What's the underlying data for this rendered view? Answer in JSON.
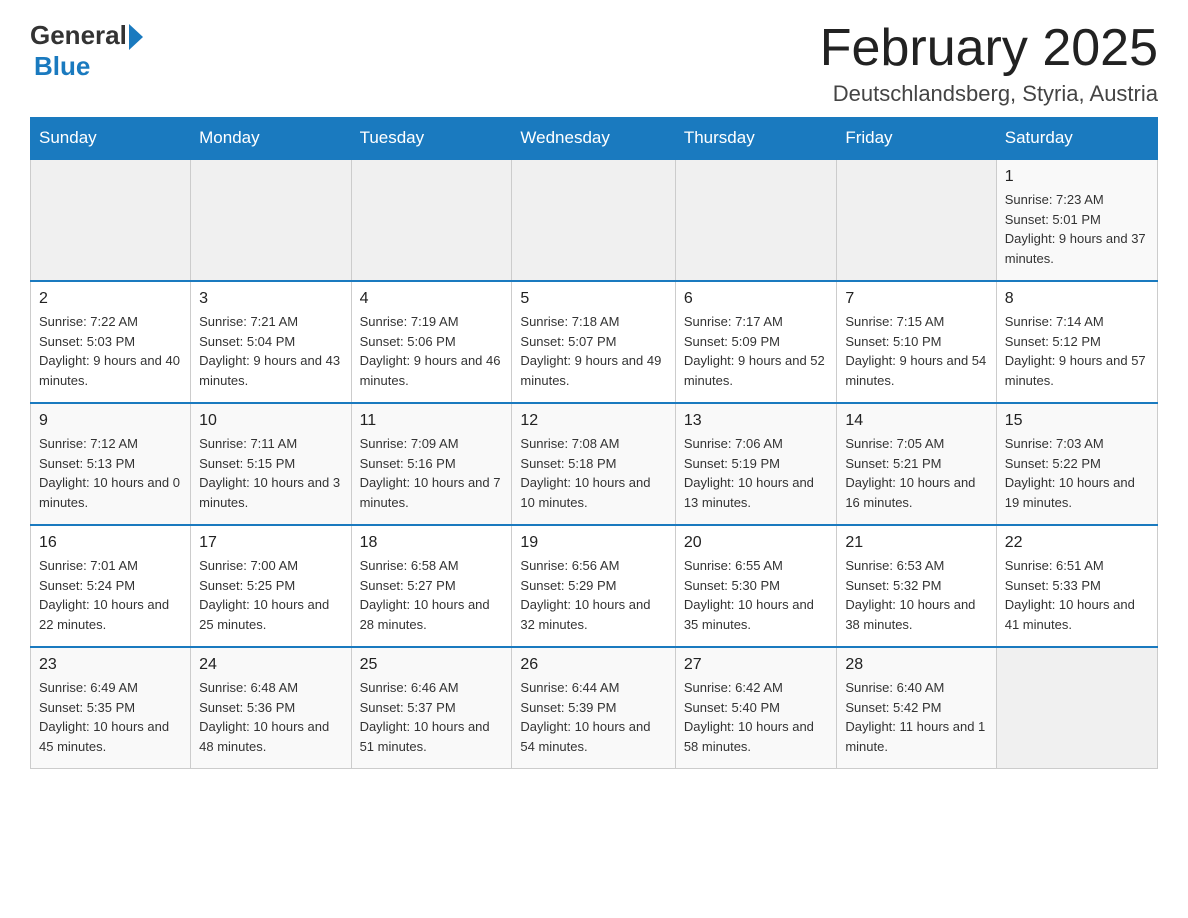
{
  "header": {
    "logo_general": "General",
    "logo_blue": "Blue",
    "month_title": "February 2025",
    "location": "Deutschlandsberg, Styria, Austria"
  },
  "weekdays": [
    "Sunday",
    "Monday",
    "Tuesday",
    "Wednesday",
    "Thursday",
    "Friday",
    "Saturday"
  ],
  "weeks": [
    [
      {
        "day": "",
        "info": ""
      },
      {
        "day": "",
        "info": ""
      },
      {
        "day": "",
        "info": ""
      },
      {
        "day": "",
        "info": ""
      },
      {
        "day": "",
        "info": ""
      },
      {
        "day": "",
        "info": ""
      },
      {
        "day": "1",
        "info": "Sunrise: 7:23 AM\nSunset: 5:01 PM\nDaylight: 9 hours and 37 minutes."
      }
    ],
    [
      {
        "day": "2",
        "info": "Sunrise: 7:22 AM\nSunset: 5:03 PM\nDaylight: 9 hours and 40 minutes."
      },
      {
        "day": "3",
        "info": "Sunrise: 7:21 AM\nSunset: 5:04 PM\nDaylight: 9 hours and 43 minutes."
      },
      {
        "day": "4",
        "info": "Sunrise: 7:19 AM\nSunset: 5:06 PM\nDaylight: 9 hours and 46 minutes."
      },
      {
        "day": "5",
        "info": "Sunrise: 7:18 AM\nSunset: 5:07 PM\nDaylight: 9 hours and 49 minutes."
      },
      {
        "day": "6",
        "info": "Sunrise: 7:17 AM\nSunset: 5:09 PM\nDaylight: 9 hours and 52 minutes."
      },
      {
        "day": "7",
        "info": "Sunrise: 7:15 AM\nSunset: 5:10 PM\nDaylight: 9 hours and 54 minutes."
      },
      {
        "day": "8",
        "info": "Sunrise: 7:14 AM\nSunset: 5:12 PM\nDaylight: 9 hours and 57 minutes."
      }
    ],
    [
      {
        "day": "9",
        "info": "Sunrise: 7:12 AM\nSunset: 5:13 PM\nDaylight: 10 hours and 0 minutes."
      },
      {
        "day": "10",
        "info": "Sunrise: 7:11 AM\nSunset: 5:15 PM\nDaylight: 10 hours and 3 minutes."
      },
      {
        "day": "11",
        "info": "Sunrise: 7:09 AM\nSunset: 5:16 PM\nDaylight: 10 hours and 7 minutes."
      },
      {
        "day": "12",
        "info": "Sunrise: 7:08 AM\nSunset: 5:18 PM\nDaylight: 10 hours and 10 minutes."
      },
      {
        "day": "13",
        "info": "Sunrise: 7:06 AM\nSunset: 5:19 PM\nDaylight: 10 hours and 13 minutes."
      },
      {
        "day": "14",
        "info": "Sunrise: 7:05 AM\nSunset: 5:21 PM\nDaylight: 10 hours and 16 minutes."
      },
      {
        "day": "15",
        "info": "Sunrise: 7:03 AM\nSunset: 5:22 PM\nDaylight: 10 hours and 19 minutes."
      }
    ],
    [
      {
        "day": "16",
        "info": "Sunrise: 7:01 AM\nSunset: 5:24 PM\nDaylight: 10 hours and 22 minutes."
      },
      {
        "day": "17",
        "info": "Sunrise: 7:00 AM\nSunset: 5:25 PM\nDaylight: 10 hours and 25 minutes."
      },
      {
        "day": "18",
        "info": "Sunrise: 6:58 AM\nSunset: 5:27 PM\nDaylight: 10 hours and 28 minutes."
      },
      {
        "day": "19",
        "info": "Sunrise: 6:56 AM\nSunset: 5:29 PM\nDaylight: 10 hours and 32 minutes."
      },
      {
        "day": "20",
        "info": "Sunrise: 6:55 AM\nSunset: 5:30 PM\nDaylight: 10 hours and 35 minutes."
      },
      {
        "day": "21",
        "info": "Sunrise: 6:53 AM\nSunset: 5:32 PM\nDaylight: 10 hours and 38 minutes."
      },
      {
        "day": "22",
        "info": "Sunrise: 6:51 AM\nSunset: 5:33 PM\nDaylight: 10 hours and 41 minutes."
      }
    ],
    [
      {
        "day": "23",
        "info": "Sunrise: 6:49 AM\nSunset: 5:35 PM\nDaylight: 10 hours and 45 minutes."
      },
      {
        "day": "24",
        "info": "Sunrise: 6:48 AM\nSunset: 5:36 PM\nDaylight: 10 hours and 48 minutes."
      },
      {
        "day": "25",
        "info": "Sunrise: 6:46 AM\nSunset: 5:37 PM\nDaylight: 10 hours and 51 minutes."
      },
      {
        "day": "26",
        "info": "Sunrise: 6:44 AM\nSunset: 5:39 PM\nDaylight: 10 hours and 54 minutes."
      },
      {
        "day": "27",
        "info": "Sunrise: 6:42 AM\nSunset: 5:40 PM\nDaylight: 10 hours and 58 minutes."
      },
      {
        "day": "28",
        "info": "Sunrise: 6:40 AM\nSunset: 5:42 PM\nDaylight: 11 hours and 1 minute."
      },
      {
        "day": "",
        "info": ""
      }
    ]
  ]
}
